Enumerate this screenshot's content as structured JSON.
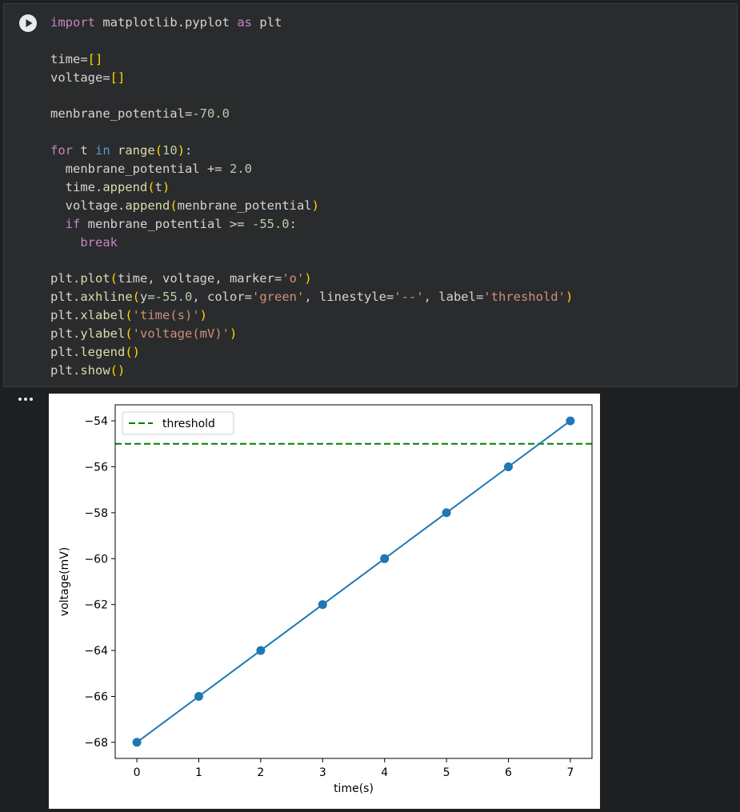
{
  "notebook": {
    "run_button_label": "Run cell",
    "output_menu_label": "...",
    "code_lines": [
      [
        {
          "t": "import",
          "c": "kw"
        },
        {
          "t": " matplotlib.pyplot ",
          "c": "txt"
        },
        {
          "t": "as",
          "c": "kw"
        },
        {
          "t": " plt",
          "c": "txt"
        }
      ],
      [],
      [
        {
          "t": "time=",
          "c": "txt"
        },
        {
          "t": "[]",
          "c": "brk"
        }
      ],
      [
        {
          "t": "voltage=",
          "c": "txt"
        },
        {
          "t": "[]",
          "c": "brk"
        }
      ],
      [],
      [
        {
          "t": "menbrane_potential=",
          "c": "txt"
        },
        {
          "t": "-70.0",
          "c": "num"
        }
      ],
      [],
      [
        {
          "t": "for",
          "c": "kw"
        },
        {
          "t": " t ",
          "c": "txt"
        },
        {
          "t": "in",
          "c": "kw2"
        },
        {
          "t": " ",
          "c": "txt"
        },
        {
          "t": "range",
          "c": "fn"
        },
        {
          "t": "(",
          "c": "brk"
        },
        {
          "t": "10",
          "c": "num"
        },
        {
          "t": ")",
          "c": "brk"
        },
        {
          "t": ":",
          "c": "txt"
        }
      ],
      [
        {
          "t": "  menbrane_potential += ",
          "c": "txt"
        },
        {
          "t": "2.0",
          "c": "num"
        }
      ],
      [
        {
          "t": "  time.",
          "c": "txt"
        },
        {
          "t": "append",
          "c": "fn"
        },
        {
          "t": "(",
          "c": "brk"
        },
        {
          "t": "t",
          "c": "txt"
        },
        {
          "t": ")",
          "c": "brk"
        }
      ],
      [
        {
          "t": "  voltage.",
          "c": "txt"
        },
        {
          "t": "append",
          "c": "fn"
        },
        {
          "t": "(",
          "c": "brk"
        },
        {
          "t": "menbrane_potential",
          "c": "txt"
        },
        {
          "t": ")",
          "c": "brk"
        }
      ],
      [
        {
          "t": "  ",
          "c": "txt"
        },
        {
          "t": "if",
          "c": "kw"
        },
        {
          "t": " menbrane_potential >= ",
          "c": "txt"
        },
        {
          "t": "-55.0",
          "c": "num"
        },
        {
          "t": ":",
          "c": "txt"
        }
      ],
      [
        {
          "t": "    ",
          "c": "txt"
        },
        {
          "t": "break",
          "c": "kw"
        }
      ],
      [],
      [
        {
          "t": "plt.",
          "c": "txt"
        },
        {
          "t": "plot",
          "c": "fn"
        },
        {
          "t": "(",
          "c": "brk"
        },
        {
          "t": "time, voltage, marker=",
          "c": "txt"
        },
        {
          "t": "'o'",
          "c": "str"
        },
        {
          "t": ")",
          "c": "brk"
        }
      ],
      [
        {
          "t": "plt.",
          "c": "txt"
        },
        {
          "t": "axhline",
          "c": "fn"
        },
        {
          "t": "(",
          "c": "brk"
        },
        {
          "t": "y=",
          "c": "txt"
        },
        {
          "t": "-55.0",
          "c": "num"
        },
        {
          "t": ", color=",
          "c": "txt"
        },
        {
          "t": "'green'",
          "c": "str"
        },
        {
          "t": ", linestyle=",
          "c": "txt"
        },
        {
          "t": "'--'",
          "c": "str"
        },
        {
          "t": ", label=",
          "c": "txt"
        },
        {
          "t": "'threshold'",
          "c": "str"
        },
        {
          "t": ")",
          "c": "brk"
        }
      ],
      [
        {
          "t": "plt.",
          "c": "txt"
        },
        {
          "t": "xlabel",
          "c": "fn"
        },
        {
          "t": "(",
          "c": "brk"
        },
        {
          "t": "'time(s)'",
          "c": "str"
        },
        {
          "t": ")",
          "c": "brk"
        }
      ],
      [
        {
          "t": "plt.",
          "c": "txt"
        },
        {
          "t": "ylabel",
          "c": "fn"
        },
        {
          "t": "(",
          "c": "brk"
        },
        {
          "t": "'voltage(mV)'",
          "c": "str"
        },
        {
          "t": ")",
          "c": "brk"
        }
      ],
      [
        {
          "t": "plt.",
          "c": "txt"
        },
        {
          "t": "legend",
          "c": "fn"
        },
        {
          "t": "(",
          "c": "brk"
        },
        {
          "t": ")",
          "c": "brk"
        }
      ],
      [
        {
          "t": "plt.",
          "c": "txt"
        },
        {
          "t": "show",
          "c": "fn"
        },
        {
          "t": "(",
          "c": "brk"
        },
        {
          "t": ")",
          "c": "brk"
        }
      ]
    ],
    "colors": {
      "kw": "#c586c0",
      "kw2": "#569cd6",
      "fn": "#dcdcaa",
      "num": "#b5cea8",
      "str": "#ce9178",
      "brk": "#ffd700",
      "txt": "#d4d4d4",
      "line": "#1f77b4",
      "threshold": "#008000"
    }
  },
  "chart_data": {
    "type": "line",
    "title": "",
    "xlabel": "time(s)",
    "ylabel": "voltage(mV)",
    "x": [
      0,
      1,
      2,
      3,
      4,
      5,
      6,
      7
    ],
    "series": [
      {
        "values": [
          -68,
          -66,
          -64,
          -62,
          -60,
          -58,
          -56,
          -54
        ],
        "marker": "o",
        "color": "#1f77b4"
      }
    ],
    "hlines": [
      {
        "y": -55,
        "name": "threshold",
        "color": "#008000",
        "linestyle": "--"
      }
    ],
    "xlim": [
      -0.35,
      7.35
    ],
    "ylim": [
      -68.7,
      -53.3
    ],
    "xticks": [
      0,
      1,
      2,
      3,
      4,
      5,
      6,
      7
    ],
    "xtick_labels": [
      "0",
      "1",
      "2",
      "3",
      "4",
      "5",
      "6",
      "7"
    ],
    "yticks": [
      -68,
      -66,
      -64,
      -62,
      -60,
      -58,
      -56,
      -54
    ],
    "ytick_labels": [
      "−68",
      "−66",
      "−64",
      "−62",
      "−60",
      "−58",
      "−56",
      "−54"
    ],
    "legend": {
      "position": "upper left",
      "entries": [
        "threshold"
      ]
    },
    "grid": false
  }
}
